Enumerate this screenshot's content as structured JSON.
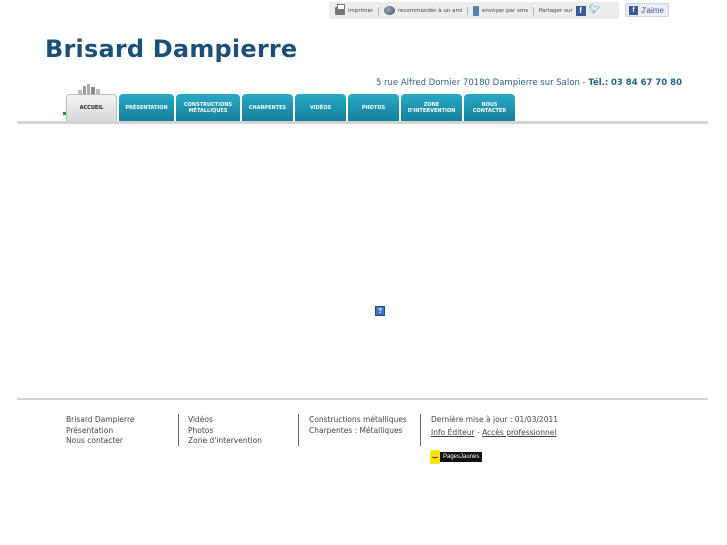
{
  "toolbar": {
    "print": "imprimer",
    "recommend": "recommander à un ami",
    "sms": "envoyer par sms",
    "share": "Partager sur",
    "like": "J'aime"
  },
  "header": {
    "title": "Brisard Dampierre",
    "address": "5 rue Alfred Dornier 70180 Dampierre sur Salon",
    "tel_label": "Tél.:",
    "tel": "03 84 67 70 80"
  },
  "nav": {
    "tabs": [
      {
        "label": "ACCUEIL",
        "active": true
      },
      {
        "label": "PRÉSENTATION"
      },
      {
        "label": "CONSTRUCTIONS MÉTALLIQUES"
      },
      {
        "label": "CHARPENTES"
      },
      {
        "label": "VIDÉOS"
      },
      {
        "label": "PHOTOS"
      },
      {
        "label": "ZONE D'INTERVENTION"
      },
      {
        "label": "NOUS CONTACTER"
      }
    ]
  },
  "main": {
    "plugin_placeholder": "?"
  },
  "footer": {
    "col1": [
      "Brisard Dampierre",
      "Présentation",
      "Nous contacter"
    ],
    "col2": [
      "Vidéos",
      "Photos",
      "Zone d'intervention"
    ],
    "col3": [
      "Constructions métalliques",
      "Charpentes : Métalliques"
    ],
    "last_update": "Dernière mise à jour : 01/03/2011",
    "info_editeur": "Info Éditeur",
    "dash": "-",
    "acces_pro": "Accès professionnel",
    "badge": "PagesJaunes"
  },
  "colors": {
    "accent": "#1c4f78",
    "tab": "#1e9ab6",
    "brand_yellow": "#ffe300"
  }
}
